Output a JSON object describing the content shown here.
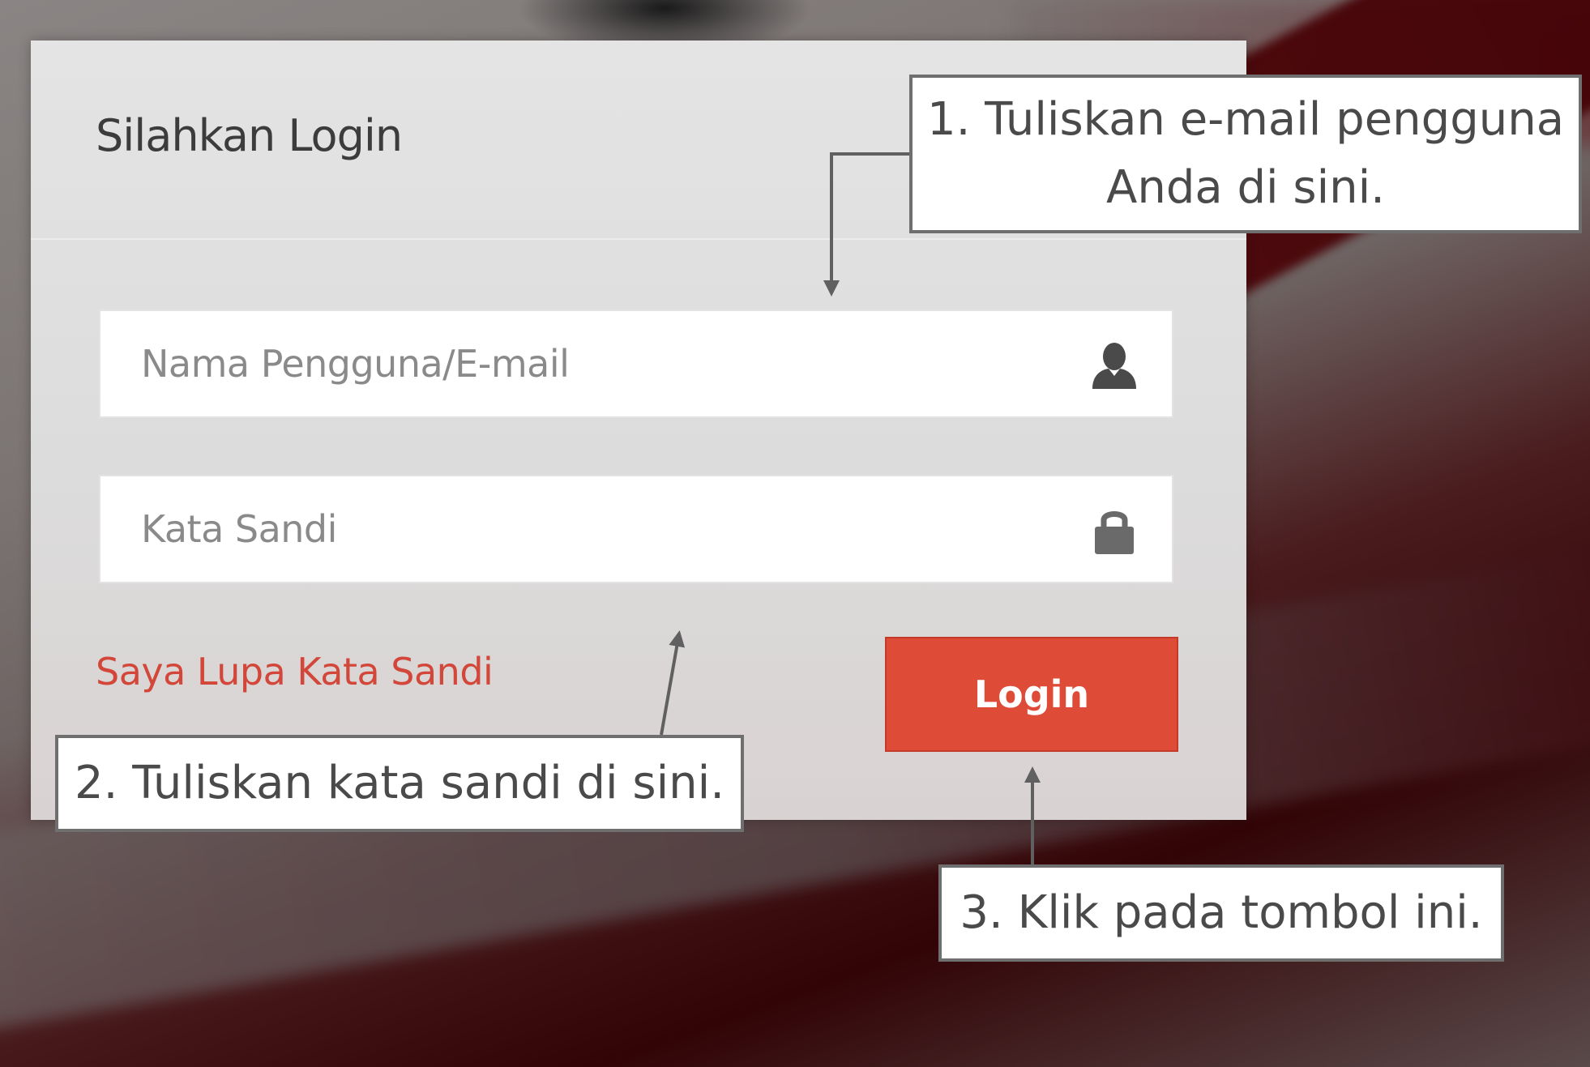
{
  "login_panel": {
    "title": "Silahkan Login",
    "username_field": {
      "placeholder": "Nama Pengguna/E-mail",
      "value": "",
      "icon": "user-icon"
    },
    "password_field": {
      "placeholder": "Kata Sandi",
      "value": "",
      "icon": "lock-icon"
    },
    "forgot_link": "Saya Lupa Kata Sandi",
    "login_button": "Login"
  },
  "annotations": {
    "step1_line1": "1. Tuliskan e-mail pengguna",
    "step1_line2": "Anda di sini.",
    "step2": "2. Tuliskan kata sandi di sini.",
    "step3": "3. Klik pada tombol ini."
  },
  "colors": {
    "accent_red": "#de4b37",
    "link_red": "#d2473a",
    "callout_border": "#6f6f6f"
  }
}
